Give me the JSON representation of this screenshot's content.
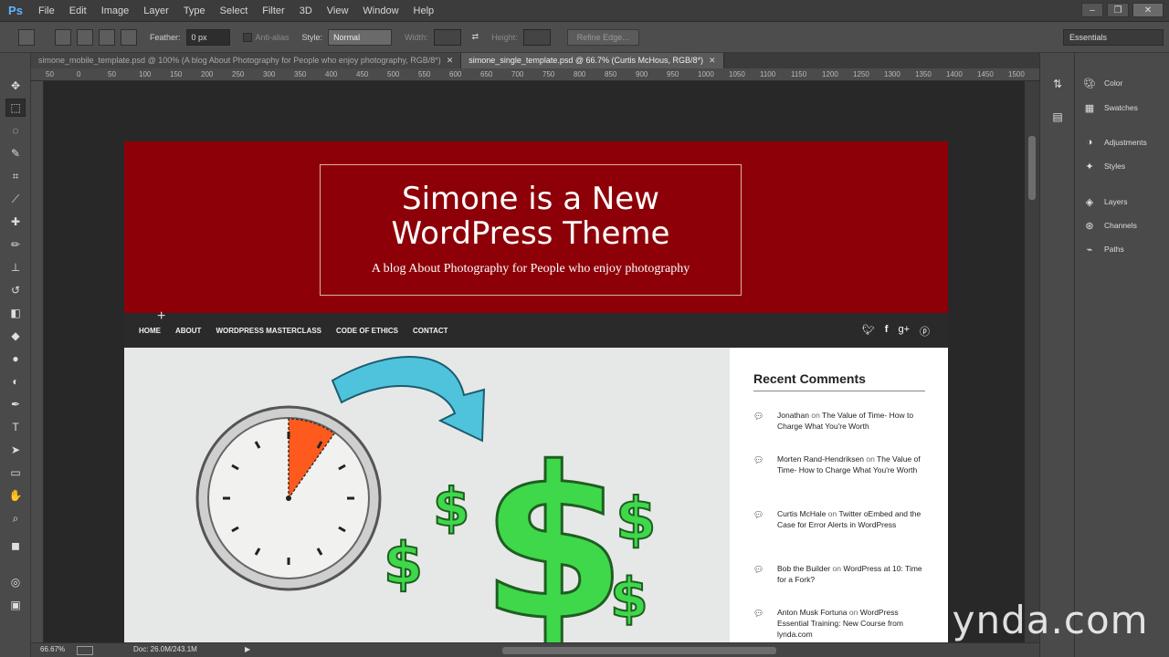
{
  "menubar": {
    "logo": "Ps",
    "items": [
      "File",
      "Edit",
      "Image",
      "Layer",
      "Type",
      "Select",
      "Filter",
      "3D",
      "View",
      "Window",
      "Help"
    ]
  },
  "options": {
    "feather_label": "Feather:",
    "feather_value": "0 px",
    "antialias_label": "Anti-alias",
    "style_label": "Style:",
    "style_value": "Normal",
    "width_label": "Width:",
    "height_label": "Height:",
    "refine_edge": "Refine Edge...",
    "workspace": "Essentials"
  },
  "tabs": [
    {
      "label": "simone_mobile_template.psd @ 100% (A blog About Photography for People who enjoy photography, RGB/8*)"
    },
    {
      "label": "simone_single_template.psd @ 66.7% (Curtis McHous, RGB/8*)"
    }
  ],
  "ruler": [
    "50",
    "0",
    "50",
    "100",
    "150",
    "200",
    "250",
    "300",
    "350",
    "400",
    "450",
    "500",
    "550",
    "600",
    "650",
    "700",
    "750",
    "800",
    "850",
    "900",
    "950",
    "1000",
    "1050",
    "1100",
    "1150",
    "1200",
    "1250",
    "1300",
    "1350",
    "1400",
    "1450",
    "1500"
  ],
  "site": {
    "title": "Simone is a New WordPress Theme",
    "tagline": "A blog About Photography for People who enjoy photography",
    "nav": [
      "HOME",
      "ABOUT",
      "WORDPRESS MASTERCLASS",
      "CODE OF ETHICS",
      "CONTACT"
    ],
    "social": [
      "𝕥",
      "f",
      "g+",
      "p"
    ]
  },
  "sidebar": {
    "title": "Recent Comments",
    "comments": [
      {
        "author": "Jonathan",
        "on": "on",
        "post": "The Value of Time- How to Charge What You're Worth"
      },
      {
        "author": "Morten Rand-Hendriksen",
        "on": "on",
        "post": "The Value of Time- How to Charge What You're Worth"
      },
      {
        "author": "Curtis McHale",
        "on": "on",
        "post": "Twitter oEmbed and the Case for Error Alerts in WordPress"
      },
      {
        "author": "Bob the Builder",
        "on": "on",
        "post": "WordPress at 10: Time for a Fork?"
      },
      {
        "author": "Anton Musk Fortuna",
        "on": "on",
        "post": "WordPress Essential Training: New Course from lynda.com"
      }
    ]
  },
  "panels": {
    "items": [
      "Color",
      "Swatches",
      "Adjustments",
      "Styles",
      "Layers",
      "Channels",
      "Paths"
    ]
  },
  "status": {
    "zoom": "66.67%",
    "doc": "Doc: 26.0M/243.1M"
  },
  "watermark": "lynda.com"
}
